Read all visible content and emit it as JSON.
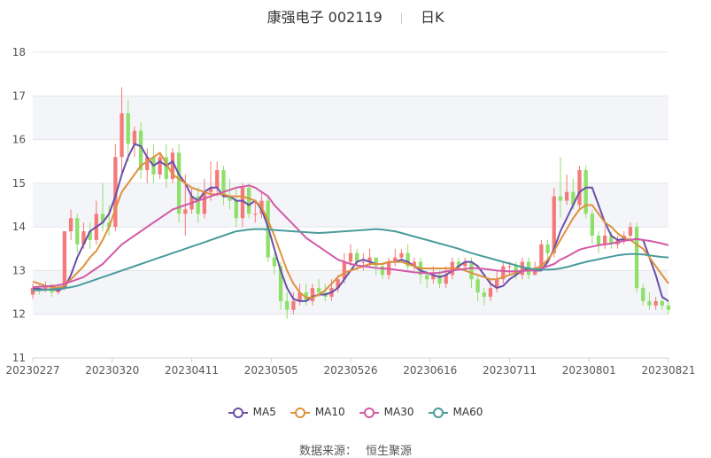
{
  "title": {
    "stock_name": "康强电子",
    "stock_code": "002119",
    "period": "日K"
  },
  "source": {
    "label": "数据来源：",
    "value": "恒生聚源"
  },
  "colors": {
    "up": "#f47a7a",
    "down": "#8ee06a",
    "MA5": "#6a4fa8",
    "MA10": "#e0913e",
    "MA30": "#d25aa6",
    "MA60": "#4b9c9c",
    "band": "#f4f5f9",
    "grid": "#e2e4ea"
  },
  "chart_data": {
    "type": "candlestick",
    "ylim": [
      11,
      18
    ],
    "yticks": [
      11,
      12,
      13,
      14,
      15,
      16,
      17,
      18
    ],
    "x_tick_labels": [
      "20230227",
      "20230320",
      "20230411",
      "20230505",
      "20230526",
      "20230616",
      "20230711",
      "20230801",
      "20230821"
    ],
    "legend": [
      "MA5",
      "MA10",
      "MA30",
      "MA60"
    ],
    "grid": "horizontal",
    "legend_position": "bottom",
    "candles": [
      [
        12.45,
        12.6,
        12.35,
        12.7
      ],
      [
        12.6,
        12.55,
        12.45,
        12.7
      ],
      [
        12.55,
        12.65,
        12.5,
        12.75
      ],
      [
        12.65,
        12.5,
        12.4,
        12.7
      ],
      [
        12.5,
        12.6,
        12.45,
        12.7
      ],
      [
        12.6,
        13.9,
        12.55,
        13.9
      ],
      [
        13.9,
        14.2,
        13.7,
        14.4
      ],
      [
        14.2,
        13.6,
        13.4,
        14.3
      ],
      [
        13.6,
        13.9,
        13.5,
        14.1
      ],
      [
        13.9,
        13.7,
        13.5,
        14.1
      ],
      [
        13.7,
        14.3,
        13.6,
        14.6
      ],
      [
        14.3,
        14.1,
        13.9,
        15.0
      ],
      [
        14.1,
        14.0,
        13.8,
        14.5
      ],
      [
        14.0,
        15.6,
        13.9,
        15.9
      ],
      [
        15.6,
        16.6,
        15.2,
        17.2
      ],
      [
        16.6,
        15.9,
        15.5,
        16.9
      ],
      [
        15.9,
        16.2,
        15.6,
        16.3
      ],
      [
        16.2,
        15.3,
        15.1,
        16.4
      ],
      [
        15.3,
        15.6,
        15.0,
        15.8
      ],
      [
        15.6,
        15.2,
        15.0,
        15.9
      ],
      [
        15.2,
        15.6,
        15.1,
        15.7
      ],
      [
        15.6,
        15.1,
        14.9,
        15.9
      ],
      [
        15.1,
        15.7,
        15.0,
        15.8
      ],
      [
        15.7,
        14.3,
        14.1,
        15.9
      ],
      [
        14.3,
        14.4,
        13.8,
        15.2
      ],
      [
        14.4,
        14.7,
        14.3,
        14.9
      ],
      [
        14.7,
        14.3,
        14.1,
        14.9
      ],
      [
        14.3,
        14.8,
        14.2,
        15.1
      ],
      [
        14.8,
        14.9,
        14.6,
        15.5
      ],
      [
        14.9,
        15.3,
        14.7,
        15.5
      ],
      [
        15.3,
        14.7,
        14.5,
        15.4
      ],
      [
        14.7,
        14.6,
        14.4,
        15.1
      ],
      [
        14.6,
        14.2,
        14.0,
        14.9
      ],
      [
        14.2,
        14.9,
        14.0,
        15.0
      ],
      [
        14.9,
        14.3,
        14.2,
        15.0
      ],
      [
        14.3,
        14.3,
        14.1,
        14.6
      ],
      [
        14.3,
        14.6,
        14.2,
        14.8
      ],
      [
        14.6,
        13.3,
        13.2,
        14.7
      ],
      [
        13.3,
        13.1,
        12.9,
        13.4
      ],
      [
        13.1,
        12.3,
        12.1,
        13.2
      ],
      [
        12.3,
        12.1,
        11.9,
        12.5
      ],
      [
        12.1,
        12.3,
        12.0,
        12.5
      ],
      [
        12.3,
        12.5,
        12.2,
        12.7
      ],
      [
        12.5,
        12.3,
        12.2,
        12.7
      ],
      [
        12.3,
        12.6,
        12.2,
        12.7
      ],
      [
        12.6,
        12.5,
        12.4,
        12.8
      ],
      [
        12.5,
        12.4,
        12.3,
        12.7
      ],
      [
        12.4,
        12.6,
        12.3,
        12.8
      ],
      [
        12.6,
        12.8,
        12.5,
        12.9
      ],
      [
        12.8,
        13.2,
        12.7,
        13.4
      ],
      [
        13.2,
        13.4,
        13.1,
        13.6
      ],
      [
        13.4,
        13.2,
        13.0,
        13.5
      ],
      [
        13.2,
        13.2,
        13.0,
        13.4
      ],
      [
        13.2,
        13.3,
        13.1,
        13.5
      ],
      [
        13.3,
        13.1,
        12.9,
        13.3
      ],
      [
        13.1,
        12.9,
        12.8,
        13.2
      ],
      [
        12.9,
        13.2,
        12.8,
        13.3
      ],
      [
        13.2,
        13.3,
        13.1,
        13.5
      ],
      [
        13.3,
        13.4,
        13.2,
        13.5
      ],
      [
        13.4,
        13.1,
        13.0,
        13.6
      ],
      [
        13.1,
        13.2,
        13.0,
        13.3
      ],
      [
        13.2,
        12.9,
        12.7,
        13.3
      ],
      [
        12.9,
        12.8,
        12.6,
        13.0
      ],
      [
        12.8,
        12.9,
        12.7,
        13.1
      ],
      [
        12.9,
        12.7,
        12.6,
        13.0
      ],
      [
        12.7,
        12.9,
        12.6,
        13.1
      ],
      [
        12.9,
        13.2,
        12.8,
        13.3
      ],
      [
        13.2,
        13.1,
        13.0,
        13.3
      ],
      [
        13.1,
        13.2,
        13.0,
        13.3
      ],
      [
        13.2,
        12.8,
        12.6,
        13.3
      ],
      [
        12.8,
        12.5,
        12.3,
        12.9
      ],
      [
        12.5,
        12.4,
        12.2,
        12.6
      ],
      [
        12.4,
        12.6,
        12.3,
        12.8
      ],
      [
        12.6,
        12.8,
        12.5,
        13.0
      ],
      [
        12.8,
        13.1,
        12.7,
        13.2
      ],
      [
        13.1,
        13.1,
        12.9,
        13.2
      ],
      [
        13.1,
        12.9,
        12.8,
        13.2
      ],
      [
        12.9,
        13.2,
        12.8,
        13.3
      ],
      [
        13.2,
        12.9,
        12.8,
        13.3
      ],
      [
        12.9,
        13.0,
        12.9,
        13.2
      ],
      [
        13.0,
        13.6,
        13.0,
        13.7
      ],
      [
        13.6,
        13.4,
        13.2,
        13.7
      ],
      [
        13.4,
        14.7,
        13.3,
        14.9
      ],
      [
        14.7,
        14.6,
        14.2,
        15.6
      ],
      [
        14.6,
        14.8,
        14.5,
        15.2
      ],
      [
        14.8,
        14.5,
        14.4,
        15.1
      ],
      [
        14.5,
        15.3,
        14.4,
        15.4
      ],
      [
        15.3,
        14.3,
        14.2,
        15.4
      ],
      [
        14.3,
        13.8,
        13.6,
        14.4
      ],
      [
        13.8,
        13.6,
        13.4,
        13.9
      ],
      [
        13.6,
        13.8,
        13.5,
        14.0
      ],
      [
        13.8,
        13.6,
        13.5,
        13.9
      ],
      [
        13.6,
        13.7,
        13.5,
        13.8
      ],
      [
        13.7,
        13.8,
        13.6,
        13.9
      ],
      [
        13.8,
        14.0,
        13.7,
        14.1
      ],
      [
        14.0,
        12.6,
        12.5,
        14.1
      ],
      [
        12.6,
        12.3,
        12.2,
        12.7
      ],
      [
        12.3,
        12.2,
        12.1,
        12.5
      ],
      [
        12.2,
        12.3,
        12.1,
        12.4
      ],
      [
        12.3,
        12.2,
        12.1,
        12.4
      ],
      [
        12.2,
        12.1,
        12.0,
        12.3
      ]
    ],
    "series": [
      {
        "name": "MA5",
        "values": [
          12.6,
          12.58,
          12.56,
          12.57,
          12.55,
          12.6,
          12.9,
          13.3,
          13.6,
          13.9,
          14.0,
          14.1,
          14.3,
          14.7,
          15.2,
          15.6,
          15.9,
          15.85,
          15.6,
          15.4,
          15.5,
          15.4,
          15.5,
          15.2,
          15.0,
          14.7,
          14.6,
          14.8,
          14.9,
          14.9,
          14.7,
          14.7,
          14.6,
          14.6,
          14.5,
          14.6,
          14.4,
          14.0,
          13.5,
          13.0,
          12.6,
          12.35,
          12.3,
          12.3,
          12.4,
          12.45,
          12.45,
          12.5,
          12.6,
          12.8,
          13.0,
          13.2,
          13.25,
          13.2,
          13.15,
          13.15,
          13.2,
          13.2,
          13.25,
          13.2,
          13.1,
          13.0,
          12.95,
          12.9,
          12.85,
          12.9,
          13.0,
          13.1,
          13.2,
          13.2,
          13.1,
          12.9,
          12.7,
          12.6,
          12.65,
          12.8,
          12.9,
          13.0,
          13.05,
          13.0,
          13.0,
          13.2,
          13.5,
          13.9,
          14.2,
          14.5,
          14.8,
          14.9,
          14.9,
          14.5,
          14.1,
          13.8,
          13.7,
          13.72,
          13.7,
          13.72,
          13.7,
          13.3,
          12.9,
          12.4,
          12.3
        ]
      },
      {
        "name": "MA10",
        "values": [
          12.75,
          12.7,
          12.65,
          12.62,
          12.6,
          12.65,
          12.8,
          12.95,
          13.1,
          13.3,
          13.45,
          13.7,
          14.0,
          14.4,
          14.8,
          15.0,
          15.2,
          15.4,
          15.5,
          15.6,
          15.7,
          15.45,
          15.2,
          15.1,
          15.0,
          14.9,
          14.85,
          14.8,
          14.75,
          14.75,
          14.75,
          14.7,
          14.7,
          14.7,
          14.65,
          14.6,
          14.45,
          14.15,
          13.8,
          13.4,
          13.0,
          12.7,
          12.5,
          12.38,
          12.38,
          12.45,
          12.55,
          12.7,
          12.85,
          12.95,
          13.0,
          13.05,
          13.1,
          13.15,
          13.15,
          13.15,
          13.2,
          13.2,
          13.2,
          13.15,
          13.1,
          13.05,
          13.05,
          13.05,
          13.05,
          13.05,
          13.05,
          13.05,
          13.0,
          12.95,
          12.9,
          12.85,
          12.8,
          12.8,
          12.85,
          12.9,
          12.95,
          13.0,
          13.0,
          13.05,
          13.1,
          13.25,
          13.45,
          13.7,
          13.95,
          14.2,
          14.4,
          14.5,
          14.5,
          14.3,
          14.1,
          14.0,
          13.85,
          13.75,
          13.7,
          13.6,
          13.5,
          13.3,
          13.1,
          12.9,
          12.7
        ]
      },
      {
        "name": "MA30",
        "values": [
          12.62,
          12.63,
          12.64,
          12.65,
          12.66,
          12.7,
          12.75,
          12.8,
          12.85,
          12.95,
          13.05,
          13.15,
          13.3,
          13.45,
          13.6,
          13.7,
          13.8,
          13.9,
          14.0,
          14.1,
          14.2,
          14.3,
          14.4,
          14.45,
          14.5,
          14.55,
          14.6,
          14.65,
          14.7,
          14.75,
          14.8,
          14.85,
          14.9,
          14.92,
          14.95,
          14.9,
          14.8,
          14.7,
          14.5,
          14.35,
          14.2,
          14.05,
          13.9,
          13.75,
          13.65,
          13.55,
          13.45,
          13.35,
          13.25,
          13.2,
          13.15,
          13.12,
          13.1,
          13.08,
          13.06,
          13.05,
          13.04,
          13.02,
          13.0,
          12.98,
          12.96,
          12.95,
          12.94,
          12.94,
          12.95,
          12.98,
          13.0,
          13.02,
          13.04,
          13.06,
          13.05,
          13.04,
          13.02,
          13.0,
          12.99,
          12.98,
          12.98,
          12.99,
          13.0,
          13.0,
          13.05,
          13.1,
          13.15,
          13.25,
          13.32,
          13.4,
          13.48,
          13.52,
          13.55,
          13.58,
          13.6,
          13.62,
          13.65,
          13.68,
          13.7,
          13.72,
          13.7,
          13.68,
          13.65,
          13.62,
          13.58
        ]
      },
      {
        "name": "MA60",
        "values": [
          12.55,
          12.55,
          12.56,
          12.57,
          12.58,
          12.6,
          12.62,
          12.65,
          12.7,
          12.75,
          12.8,
          12.85,
          12.9,
          12.95,
          13.0,
          13.05,
          13.1,
          13.15,
          13.2,
          13.25,
          13.3,
          13.35,
          13.4,
          13.45,
          13.5,
          13.55,
          13.6,
          13.65,
          13.7,
          13.75,
          13.8,
          13.85,
          13.9,
          13.92,
          13.94,
          13.95,
          13.95,
          13.94,
          13.93,
          13.92,
          13.91,
          13.9,
          13.89,
          13.88,
          13.87,
          13.86,
          13.87,
          13.88,
          13.89,
          13.9,
          13.91,
          13.92,
          13.93,
          13.94,
          13.95,
          13.94,
          13.92,
          13.9,
          13.86,
          13.82,
          13.78,
          13.74,
          13.7,
          13.66,
          13.62,
          13.58,
          13.54,
          13.5,
          13.45,
          13.4,
          13.36,
          13.32,
          13.28,
          13.24,
          13.2,
          13.16,
          13.12,
          13.08,
          13.05,
          13.03,
          13.02,
          13.02,
          13.03,
          13.05,
          13.08,
          13.12,
          13.16,
          13.2,
          13.23,
          13.26,
          13.29,
          13.32,
          13.35,
          13.37,
          13.38,
          13.38,
          13.37,
          13.35,
          13.33,
          13.31,
          13.3
        ]
      }
    ]
  }
}
